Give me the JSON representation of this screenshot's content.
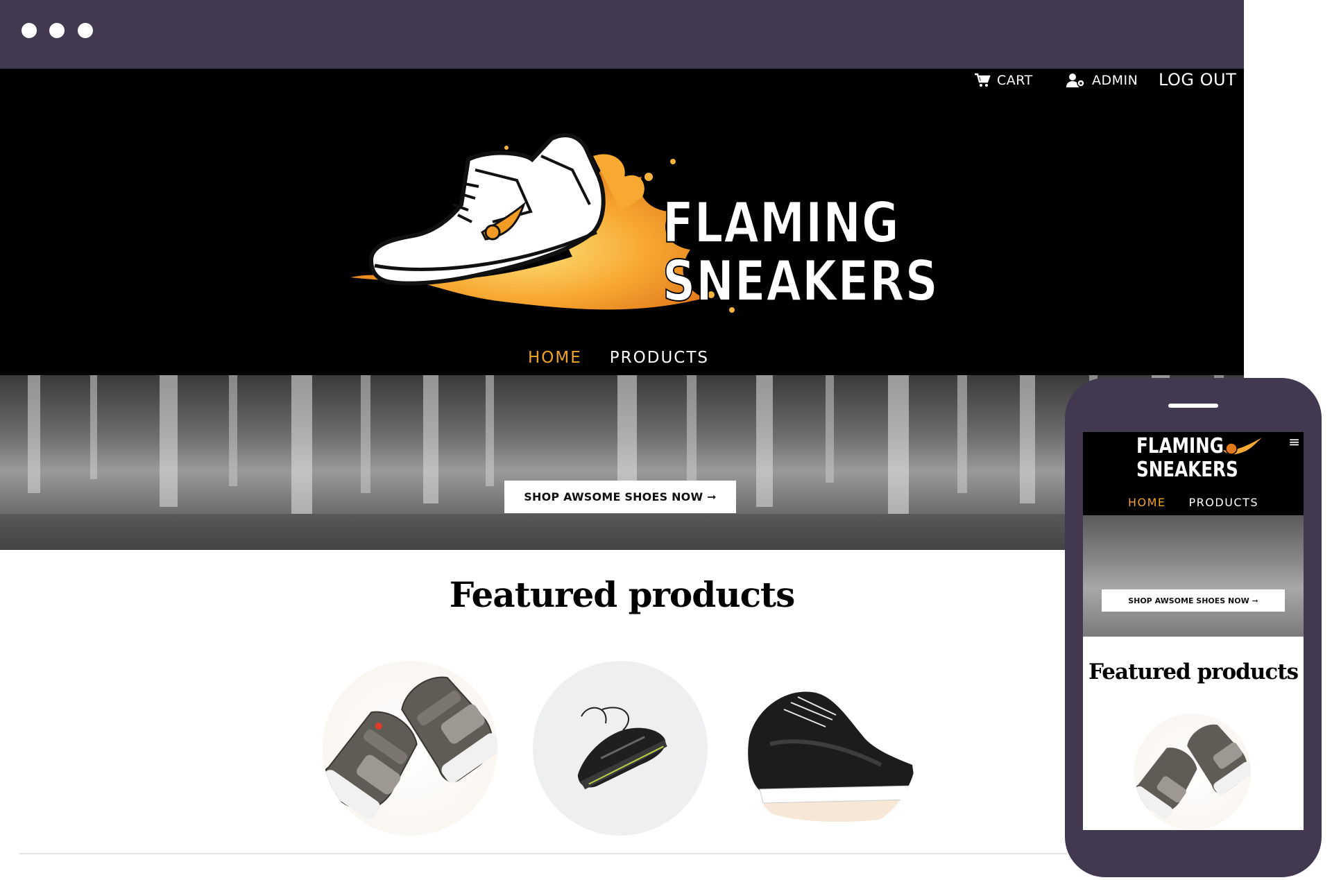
{
  "header": {
    "cart_label": "CART",
    "admin_label": "ADMIN",
    "logout_label": "LOG OUT",
    "brand_line1": "FLAMING",
    "brand_line2": "SNEAKERS"
  },
  "nav": {
    "items": [
      {
        "label": "HOME",
        "active": true
      },
      {
        "label": "PRODUCTS",
        "active": false
      }
    ]
  },
  "hero": {
    "cta_label": "SHOP AWSOME SHOES NOW ➞"
  },
  "featured": {
    "title": "Featured products",
    "products": [
      {
        "image": "grey-high-top-sneakers"
      },
      {
        "image": "black-running-shoe"
      },
      {
        "image": "black-knit-sneakers"
      }
    ]
  },
  "mobile": {
    "brand_line1": "FLAMING",
    "brand_line2": "SNEAKERS",
    "menu_icon": "≡",
    "nav": [
      {
        "label": "HOME",
        "active": true
      },
      {
        "label": "PRODUCTS",
        "active": false
      }
    ],
    "cta_label": "SHOP AWSOME SHOES NOW ➞",
    "featured_title": "Featured products"
  },
  "colors": {
    "mockup_frame": "#42384f",
    "accent": "#f0a429",
    "header_bg": "#000000"
  }
}
